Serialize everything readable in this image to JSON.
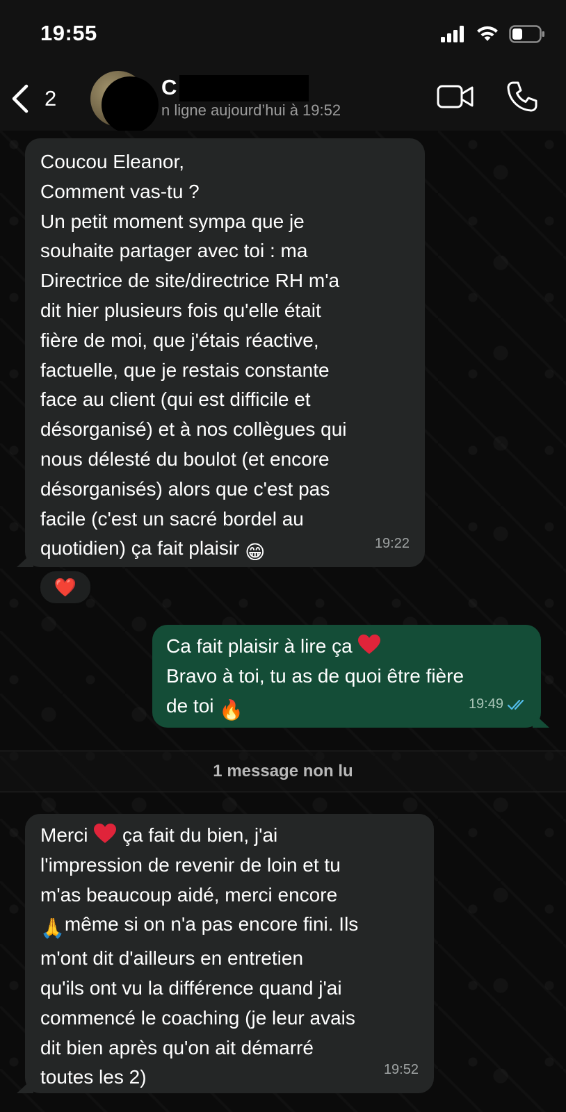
{
  "status_bar": {
    "time": "19:55",
    "icons": [
      "signal-icon",
      "wifi-icon",
      "battery-icon"
    ]
  },
  "header": {
    "back_count": "2",
    "contact_initial": "C",
    "contact_status": "n ligne aujourd’hui à 19:52",
    "icons": [
      "back-chevron-icon",
      "video-call-icon",
      "phone-call-icon"
    ]
  },
  "messages": [
    {
      "direction": "incoming",
      "lines": [
        "Coucou Eleanor,",
        "Comment vas-tu ?",
        "Un petit moment sympa que je",
        "souhaite partager avec toi : ma",
        "Directrice de site/directrice RH m'a",
        "dit hier plusieurs fois qu'elle était",
        "fière de moi, que j'étais réactive,",
        "factuelle, que je restais constante",
        "face au client (qui est difficile et",
        "désorganisé) et à nos collègues qui",
        "nous délesté du boulot (et encore",
        "désorganisés) alors que c'est pas",
        "facile (c'est un sacré bordel au",
        "quotidien) ça fait plaisir"
      ],
      "emoji": "😁",
      "time": "19:22",
      "reaction": "❤️"
    },
    {
      "direction": "outgoing",
      "line1": "Ca fait plaisir à lire ça",
      "line2": "Bravo à toi, tu as de quoi être fière",
      "line3": "de toi",
      "emoji": "🔥",
      "time": "19:49",
      "read_receipt": "double-check-icon"
    },
    {
      "direction": "incoming",
      "line1_a": "Merci",
      "line1_b": " ça fait du bien, j'ai",
      "line2": "l'impression de revenir de loin et tu",
      "line3": "m'as beaucoup aidé, merci encore",
      "line4_emoji": "🙏",
      "line4": "même si on n'a pas encore fini. Ils",
      "lines_rest": [
        "m'ont dit d'ailleurs en entretien",
        "qu'ils ont vu la différence quand j'ai",
        "commencé le coaching (je leur avais",
        "dit bien après qu'on ait démarré",
        "toutes les 2)"
      ],
      "time": "19:52"
    }
  ],
  "unread_divider": "1 message non lu",
  "colors": {
    "incoming_bubble": "#242626",
    "outgoing_bubble": "#144d37",
    "heart": "#e0243a",
    "read_tick": "#53bdeb"
  }
}
